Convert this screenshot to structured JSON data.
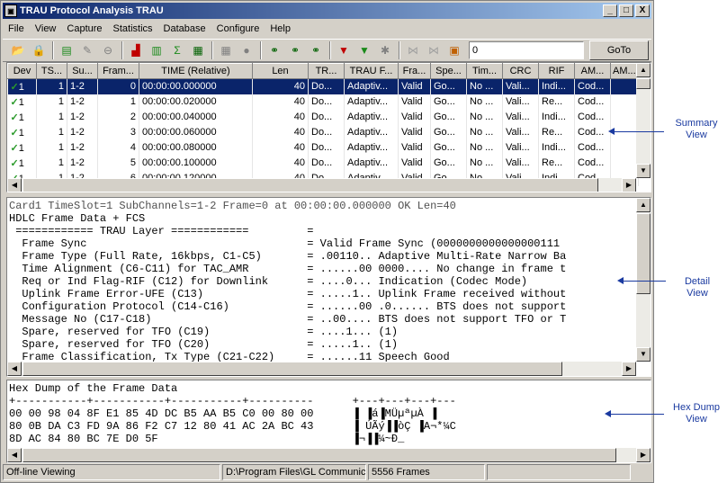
{
  "window": {
    "title": "TRAU Protocol Analysis TRAU",
    "minimize_label": "_",
    "maximize_label": "□",
    "close_label": "X"
  },
  "menu": [
    "File",
    "View",
    "Capture",
    "Statistics",
    "Database",
    "Configure",
    "Help"
  ],
  "toolbar": {
    "goto_value": "0",
    "goto_label": "GoTo"
  },
  "summary": {
    "columns": [
      "Dev",
      "TS...",
      "Su...",
      "Fram...",
      "TIME (Relative)",
      "Len",
      "TR...",
      "TRAU F...",
      "Fra...",
      "Spe...",
      "Tim...",
      "CRC",
      "RIF",
      "AM...",
      "AM..."
    ],
    "rows": [
      [
        "1",
        "1",
        "1-2",
        "0",
        "00:00:00.000000",
        "40",
        "Do...",
        "Adaptiv...",
        "Valid",
        "Go...",
        "No ...",
        "Vali...",
        "Indi...",
        "Cod...",
        ""
      ],
      [
        "1",
        "1",
        "1-2",
        "1",
        "00:00:00.020000",
        "40",
        "Do...",
        "Adaptiv...",
        "Valid",
        "Go...",
        "No ...",
        "Vali...",
        "Re...",
        "Cod...",
        ""
      ],
      [
        "1",
        "1",
        "1-2",
        "2",
        "00:00:00.040000",
        "40",
        "Do...",
        "Adaptiv...",
        "Valid",
        "Go...",
        "No ...",
        "Vali...",
        "Indi...",
        "Cod...",
        ""
      ],
      [
        "1",
        "1",
        "1-2",
        "3",
        "00:00:00.060000",
        "40",
        "Do...",
        "Adaptiv...",
        "Valid",
        "Go...",
        "No ...",
        "Vali...",
        "Re...",
        "Cod...",
        ""
      ],
      [
        "1",
        "1",
        "1-2",
        "4",
        "00:00:00.080000",
        "40",
        "Do...",
        "Adaptiv...",
        "Valid",
        "Go...",
        "No ...",
        "Vali...",
        "Indi...",
        "Cod...",
        ""
      ],
      [
        "1",
        "1",
        "1-2",
        "5",
        "00:00:00.100000",
        "40",
        "Do...",
        "Adaptiv...",
        "Valid",
        "Go...",
        "No ...",
        "Vali...",
        "Re...",
        "Cod...",
        ""
      ],
      [
        "1",
        "1",
        "1-2",
        "6",
        "00:00:00.120000",
        "40",
        "Do...",
        "Adaptiv...",
        "Valid",
        "Go...",
        "No ...",
        "Vali...",
        "Indi...",
        "Cod...",
        ""
      ]
    ]
  },
  "detail": {
    "lines": [
      "Card1 TimeSlot=1 SubChannels=1-2 Frame=0 at 00:00:00.000000 OK Len=40",
      "HDLC Frame Data + FCS",
      " ============ TRAU Layer ============         =",
      "  Frame Sync                                  = Valid Frame Sync (0000000000000000111",
      "  Frame Type (Full Rate, 16kbps, C1-C5)       = .00110.. Adaptive Multi-Rate Narrow Ba",
      "  Time Alignment (C6-C11) for TAC_AMR         = ......00 0000.... No change in frame t",
      "  Req or Ind Flag-RIF (C12) for Downlink      = ....0... Indication (Codec Mode)",
      "  Uplink Frame Error-UFE (C13)                = .....1.. Uplink Frame received without",
      "  Configuration Protocol (C14-C16)            = ......00 .0...... BTS does not support",
      "  Message No (C17-C18)                        = ..00.... BTS does not support TFO or T",
      "  Spare, reserved for TFO (C19)               = ....1... (1)",
      "  Spare, reserved for TFO (C20)               = .....1.. (1)",
      "  Frame Classification, Tx Type (C21-C22)     = ......11 Speech Good"
    ]
  },
  "hex": {
    "lines": [
      "Hex Dump of the Frame Data",
      "+-----------+-----------+-----------+----------      +---+---+---+---",
      "00 00 98 04 8F E1 85 4D DC B5 AA B5 C0 00 80 00      ▐ ▐á▐MÜµªµÀ ▐",
      "80 0B DA C3 FD 9A 86 F2 C7 12 80 41 AC 2A BC 43      ▐ ÚÃý▐▐òÇ ▐A¬*¼C",
      "8D AC 84 80 BC 7E D0 5F                              ▐¬▐▐¼~Ð_"
    ]
  },
  "status": {
    "mode": "Off-line Viewing",
    "path": "D:\\Program Files\\GL Communicat",
    "frames": "5556 Frames"
  },
  "annotations": {
    "summary": "Summary\nView",
    "detail": "Detail\nView",
    "hex": "Hex Dump\nView"
  }
}
